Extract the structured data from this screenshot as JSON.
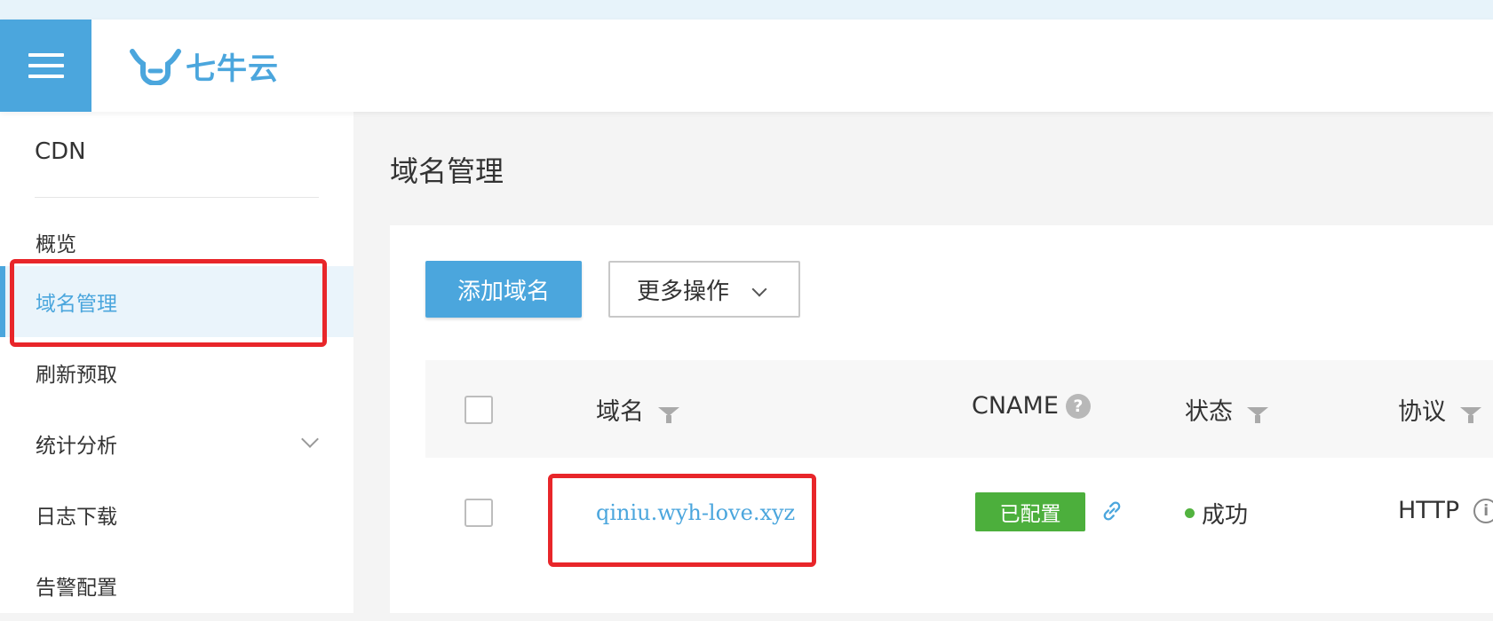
{
  "header": {
    "logo_text": "七牛云",
    "icons": {
      "menu": "hamburger-menu-icon",
      "logo": "bull-logo-icon"
    }
  },
  "sidebar": {
    "title": "CDN",
    "items": [
      {
        "label": "概览"
      },
      {
        "label": "域名管理",
        "active": true
      },
      {
        "label": "刷新预取"
      },
      {
        "label": "统计分析",
        "has_children": true
      },
      {
        "label": "日志下载"
      },
      {
        "label": "告警配置"
      }
    ]
  },
  "main": {
    "page_title": "域名管理",
    "toolbar": {
      "add_domain_label": "添加域名",
      "more_actions_label": "更多操作"
    },
    "table": {
      "columns": [
        "域名",
        "CNAME",
        "状态",
        "协议"
      ],
      "rows": [
        {
          "domain": "qiniu.wyh-love.xyz",
          "cname_badge": "已配置",
          "status": "成功",
          "protocol": "HTTP"
        }
      ]
    }
  },
  "colors": {
    "accent": "#4ba6dd",
    "success_badge": "#4caf3c",
    "status_dot": "#52b33f",
    "highlight_box": "#e8262a"
  }
}
